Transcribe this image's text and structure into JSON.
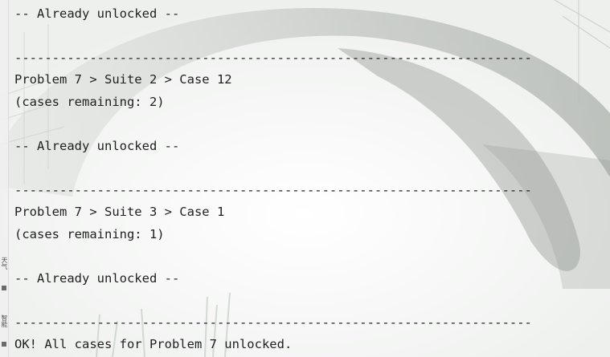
{
  "console": {
    "lines": [
      "-- Already unlocked --",
      "---------------------------------------------------------------------",
      "Problem 7 > Suite 2 > Case 12",
      "(cases remaining: 2)",
      "-- Already unlocked --",
      "---------------------------------------------------------------------",
      "Problem 7 > Suite 3 > Case 1",
      "(cases remaining: 1)",
      "-- Already unlocked --",
      "---------------------------------------------------------------------",
      "OK! All cases for Problem 7 unlocked."
    ]
  },
  "gutter": {
    "label_top": "天气",
    "label_bottom": "智能"
  },
  "theme": {
    "text_color": "#1f1f1f",
    "background_color": "#f7f8f7"
  }
}
